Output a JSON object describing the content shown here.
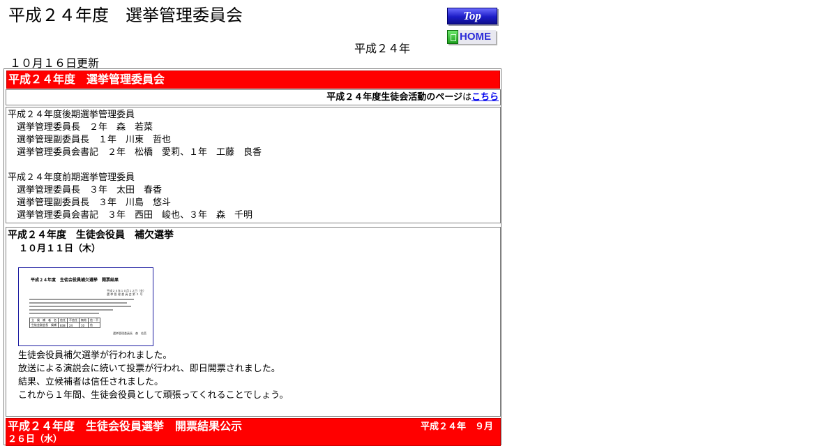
{
  "header": {
    "title": "平成２４年度　選挙管理委員会",
    "year": "平成２４年",
    "updated": "１０月１６日更新"
  },
  "nav": {
    "top_label": "Top",
    "home_label": "HOME"
  },
  "section": {
    "heading": "平成２４年度　選挙管理委員会",
    "link_text_bold": "平成２４年度生徒会活動のページ",
    "link_text_mid": "は",
    "link_label": "こちら"
  },
  "members": {
    "lines": [
      "平成２４年度後期選挙管理委員",
      "　選挙管理委員長　２年　森　若菜",
      "　選挙管理副委員長　１年　川東　哲也",
      "　選挙管理委員会書記　２年　松橋　愛莉、１年　工藤　良香",
      "",
      "平成２４年度前期選挙管理委員",
      "　選挙管理委員長　３年　太田　春香",
      "　選挙管理副委員長　３年　川島　悠斗",
      "　選挙管理委員会書記　３年　西田　峻也、３年　森　千明"
    ]
  },
  "election": {
    "title": "平成２４年度　生徒会役員　補欠選挙",
    "date": "１０月１１日（木）",
    "notice": {
      "title": "平成２４年度　生徒会役員補欠選挙　開票結果",
      "header_right": "平成２４年１０月１２日（金）\n選 挙 管 理 委 員 会 第 ２ 号",
      "table_headers": [
        "立　候　補　者　名",
        "信任",
        "不信任",
        "無効",
        "信・不"
      ],
      "table_row_role": "生徒会副会長　候補",
      "table_row_values": [
        "838",
        "24",
        "10",
        "信"
      ],
      "signature": "選挙管理委員長　森　若菜"
    },
    "body": [
      "生徒会役員補欠選挙が行われました。",
      "放送による演説会に続いて投票が行われ、即日開票されました。",
      "結果、立候補者は信任されました。",
      "これから１年間、生徒会役員として頑張ってくれることでしょう。"
    ]
  },
  "result": {
    "heading": "平成２４年度　生徒会役員選挙　開票結果公示",
    "date_part1": "平成２４年　９月",
    "date_part2": "２６日（水）"
  },
  "colors": {
    "accent_red": "#ff0000",
    "link_blue": "#0000ee",
    "top_button": "#1c1cc6",
    "home_icon": "#1fa01f"
  }
}
